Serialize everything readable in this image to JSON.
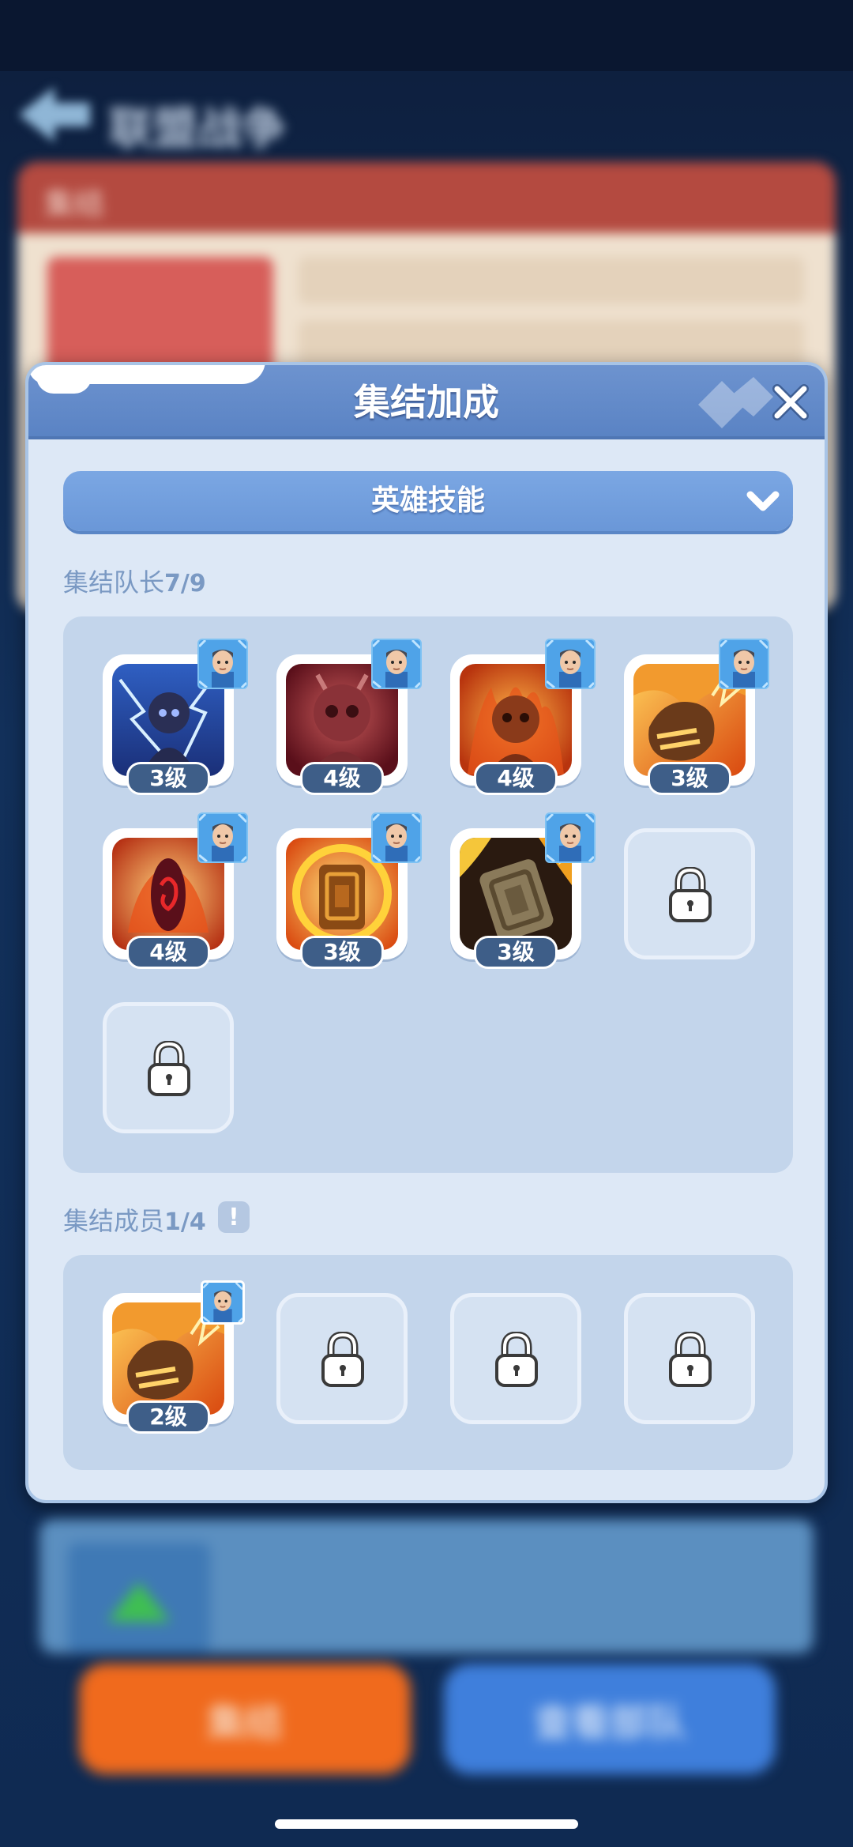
{
  "background": {
    "page_title": "联盟战争",
    "panel_header": "集结",
    "primary_button": "集结",
    "secondary_button": "查看部队"
  },
  "modal": {
    "title": "集结加成",
    "dropdown": {
      "selected": "英雄技能"
    },
    "leader_section": {
      "label": "集结队长",
      "count": "7/9"
    },
    "member_section": {
      "label": "集结成员",
      "count": "1/4",
      "info_icon": "!"
    },
    "leader_skills": [
      {
        "art": "storm-cloak-skill-icon",
        "level": "3级",
        "has_avatar": true
      },
      {
        "art": "red-beast-skill-icon",
        "level": "4级",
        "has_avatar": true
      },
      {
        "art": "flame-beast-skill-icon",
        "level": "4级",
        "has_avatar": true
      },
      {
        "art": "fire-fist-skill-icon",
        "level": "3级",
        "has_avatar": true
      },
      {
        "art": "fire-eye-skill-icon",
        "level": "4级",
        "has_avatar": true
      },
      {
        "art": "golden-shield-skill-icon",
        "level": "3级",
        "has_avatar": true
      },
      {
        "art": "stone-shield-skill-icon",
        "level": "3级",
        "has_avatar": true
      }
    ],
    "leader_locked_slots": 2,
    "member_skills": [
      {
        "art": "fire-fist-skill-icon",
        "level": "2级",
        "has_avatar": true
      }
    ],
    "member_locked_slots": 3
  },
  "colors": {
    "modal_bg": "#dde8f6",
    "header": "#6d93cf",
    "level_badge": "#3e5e88",
    "panel": "#c3d5eb"
  }
}
